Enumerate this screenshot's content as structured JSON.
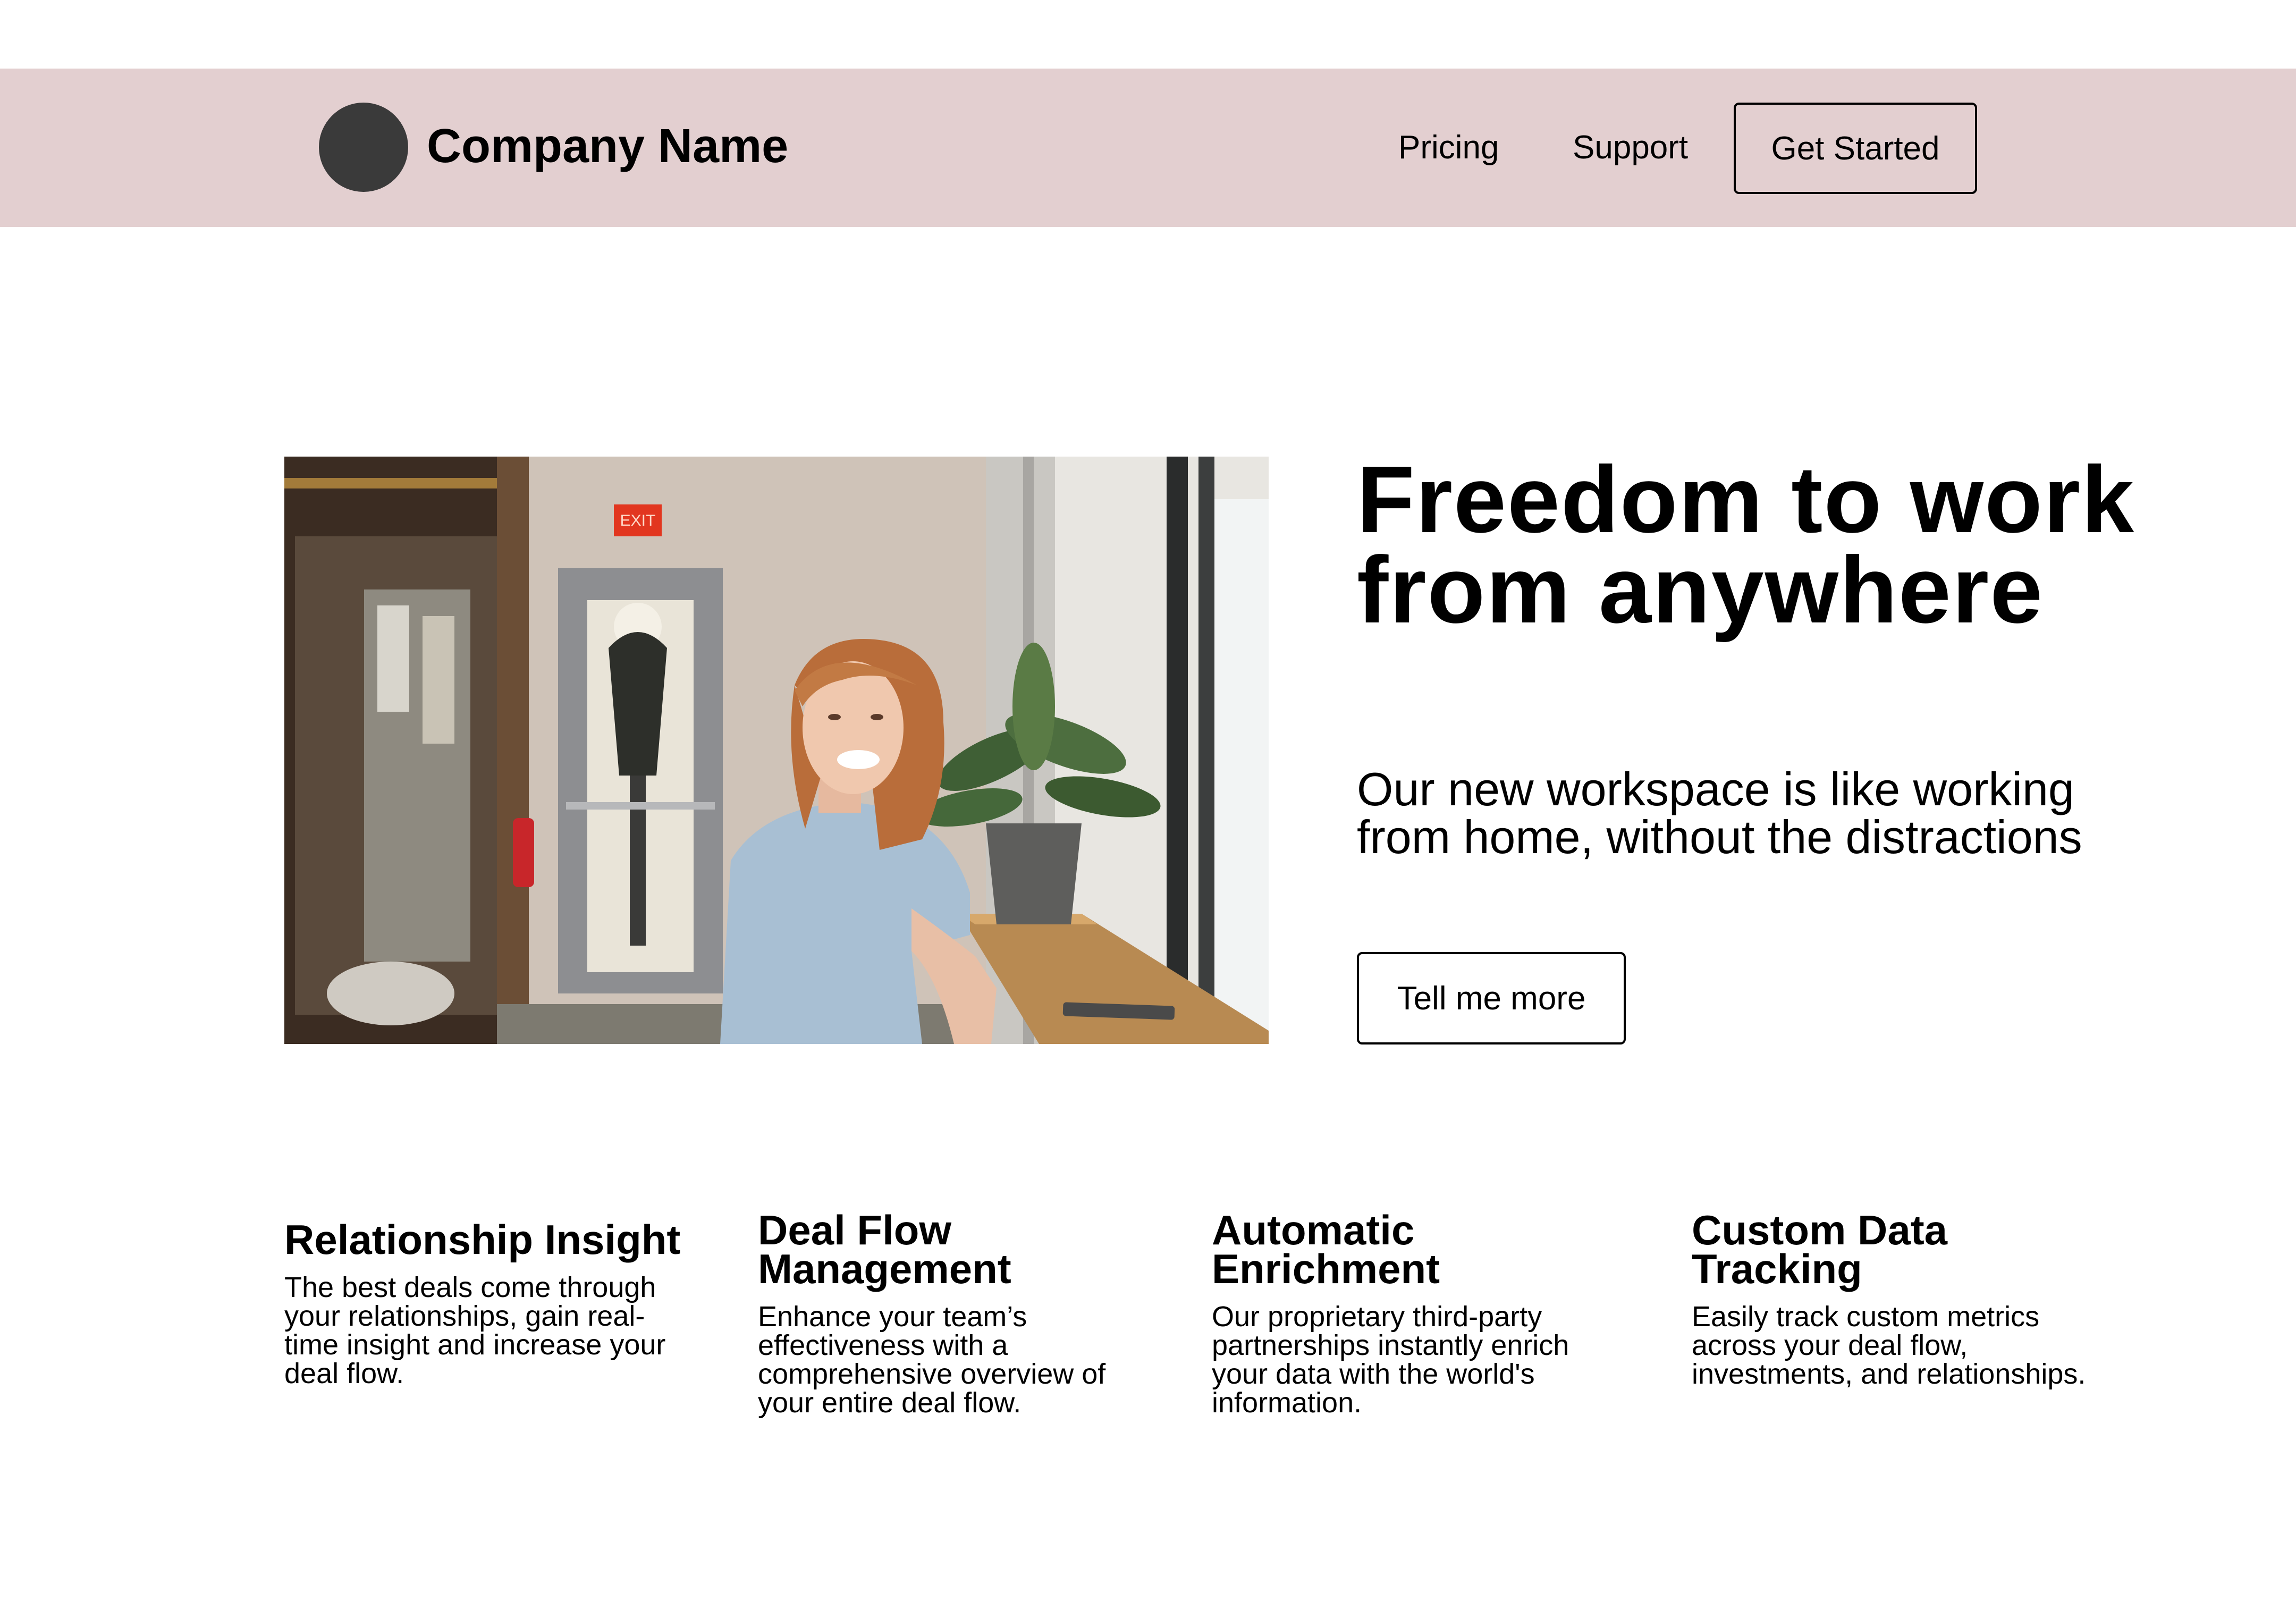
{
  "header": {
    "company_name": "Company Name",
    "nav": [
      {
        "label": "Pricing"
      },
      {
        "label": "Support"
      }
    ],
    "cta_label": "Get Started",
    "background_color": "#e3cfd0"
  },
  "hero": {
    "title": "Freedom to work from anywhere",
    "subtitle": "Our new workspace is like working from home, without the distractions",
    "cta_label": "Tell me more",
    "image_exit_sign": "EXIT"
  },
  "features": [
    {
      "title": "Relationship Insight",
      "description": "The best deals come through your relationships, gain real-time insight and increase your deal flow."
    },
    {
      "title": "Deal Flow Management",
      "description": "Enhance your team’s effectiveness with a comprehensive overview of your entire deal flow."
    },
    {
      "title": "Automatic Enrichment",
      "description": "Our proprietary third-party partnerships instantly enrich your data with the world's information."
    },
    {
      "title": "Custom Data Tracking",
      "description": "Easily track custom metrics across your deal flow, investments, and relationships."
    }
  ]
}
